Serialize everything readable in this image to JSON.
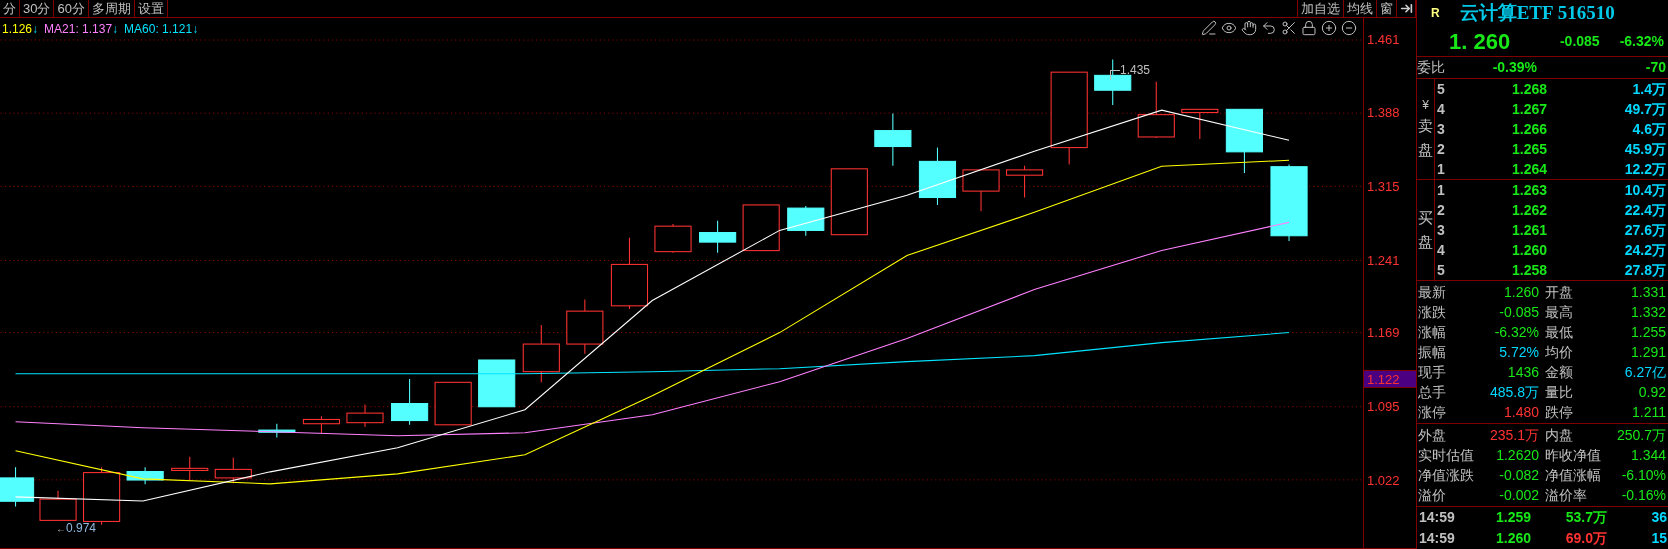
{
  "tabs": [
    {
      "label": "分",
      "selected": false
    },
    {
      "label": "30分",
      "selected": false
    },
    {
      "label": "60分",
      "selected": false
    },
    {
      "label": "多周期",
      "selected": false
    },
    {
      "label": "设置",
      "selected": false
    }
  ],
  "top_buttons": [
    "加自选",
    "均线",
    "窗"
  ],
  "ma_legend": [
    {
      "text": "1.126",
      "arrow": "↓",
      "color": "#ffff00"
    },
    {
      "text": "MA21: 1.137",
      "arrow": "↓",
      "color": "#ff80ff"
    },
    {
      "text": "MA60: 1.121",
      "arrow": "↓",
      "color": "#00e5ff"
    }
  ],
  "chart_data": {
    "type": "line",
    "grid": true,
    "ylim": [
      0.954,
      1.483
    ],
    "yticks": [
      {
        "value": 1.461,
        "label": "1.461"
      },
      {
        "value": 1.388,
        "label": "1.388"
      },
      {
        "value": 1.315,
        "label": "1.315"
      },
      {
        "value": 1.241,
        "label": "1.241"
      },
      {
        "value": 1.169,
        "label": "1.169"
      },
      {
        "value": 1.095,
        "label": "1.095"
      },
      {
        "value": 1.022,
        "label": "1.022"
      }
    ],
    "series": [
      {
        "color": "#00e5ff",
        "values": [
          1.128,
          1.128,
          1.128,
          1.128,
          1.128,
          1.13,
          1.133,
          1.14,
          1.146,
          1.159,
          1.169
        ]
      },
      {
        "color": "#ff80ff",
        "values": [
          1.08,
          1.074,
          1.07,
          1.066,
          1.069,
          1.087,
          1.12,
          1.163,
          1.212,
          1.251,
          1.279
        ]
      },
      {
        "color": "#ffff00",
        "values": [
          1.051,
          1.023,
          1.018,
          1.028,
          1.047,
          1.106,
          1.169,
          1.246,
          1.289,
          1.335,
          1.341
        ]
      },
      {
        "color": "#ffffff",
        "values": [
          1.005,
          1.001,
          1.03,
          1.054,
          1.092,
          1.201,
          1.271,
          1.306,
          1.35,
          1.391,
          1.361
        ]
      }
    ]
  },
  "chart_labels": {
    "high": "1.435",
    "low": "0.974",
    "low_arrow": "←"
  },
  "axis": {
    "current": "1.122"
  },
  "quote": {
    "flag": "R",
    "name": "云计算ETF 516510",
    "price": "1. 260",
    "change": "-0.085",
    "pct": "-6.32%"
  },
  "weibi": {
    "label": "委比",
    "pct": "-0.39%",
    "diff": "-70"
  },
  "sell": {
    "mark": "¥",
    "label": "卖盘",
    "rows": [
      {
        "level": "5",
        "price": "1.268",
        "volume": "1.4万"
      },
      {
        "level": "4",
        "price": "1.267",
        "volume": "49.7万"
      },
      {
        "level": "3",
        "price": "1.266",
        "volume": "4.6万"
      },
      {
        "level": "2",
        "price": "1.265",
        "volume": "45.9万"
      },
      {
        "level": "1",
        "price": "1.264",
        "volume": "12.2万"
      }
    ]
  },
  "buy": {
    "label": "买盘",
    "rows": [
      {
        "level": "1",
        "price": "1.263",
        "volume": "10.4万"
      },
      {
        "level": "2",
        "price": "1.262",
        "volume": "22.4万"
      },
      {
        "level": "3",
        "price": "1.261",
        "volume": "27.6万"
      },
      {
        "level": "4",
        "price": "1.260",
        "volume": "24.2万"
      },
      {
        "level": "5",
        "price": "1.258",
        "volume": "27.8万"
      }
    ]
  },
  "stats": [
    {
      "label": "最新",
      "value": "1.260",
      "color": "#18e818"
    },
    {
      "label": "开盘",
      "value": "1.331",
      "color": "#18e818"
    },
    {
      "label": "涨跌",
      "value": "-0.085",
      "color": "#18e818"
    },
    {
      "label": "最高",
      "value": "1.332",
      "color": "#18e818"
    },
    {
      "label": "涨幅",
      "value": "-6.32%",
      "color": "#18e818"
    },
    {
      "label": "最低",
      "value": "1.255",
      "color": "#18e818"
    },
    {
      "label": "振幅",
      "value": "5.72%",
      "color": "#00d8ff"
    },
    {
      "label": "均价",
      "value": "1.291",
      "color": "#18e818"
    },
    {
      "label": "现手",
      "value": "1436",
      "color": "#18e818"
    },
    {
      "label": "金额",
      "value": "6.27亿",
      "color": "#00d8ff"
    },
    {
      "label": "总手",
      "value": "485.8万",
      "color": "#00d8ff"
    },
    {
      "label": "量比",
      "value": "0.92",
      "color": "#18e818"
    },
    {
      "label": "涨停",
      "value": "1.480",
      "color": "#ff3232"
    },
    {
      "label": "跌停",
      "value": "1.211",
      "color": "#18e818"
    }
  ],
  "stats2": [
    {
      "label": "外盘",
      "value": "235.1万",
      "color": "#ff3232"
    },
    {
      "label": "内盘",
      "value": "250.7万",
      "color": "#18e818"
    },
    {
      "label": "实时估值",
      "value": "1.2620",
      "color": "#18e818"
    },
    {
      "label": "昨收净值",
      "value": "1.344",
      "color": "#18e818"
    },
    {
      "label": "净值涨跌",
      "value": "-0.082",
      "color": "#18e818"
    },
    {
      "label": "净值涨幅",
      "value": "-6.10%",
      "color": "#18e818"
    },
    {
      "label": "溢价",
      "value": "-0.002",
      "color": "#18e818"
    },
    {
      "label": "溢价率",
      "value": "-0.16%",
      "color": "#18e818"
    }
  ],
  "trades": [
    {
      "time": "14:59",
      "price": "1.259",
      "volume": "53.7万",
      "color": "#18e818",
      "count": "36"
    },
    {
      "time": "14:59",
      "price": "1.260",
      "volume": "69.0万",
      "color": "#ff3232",
      "count": "15"
    }
  ]
}
